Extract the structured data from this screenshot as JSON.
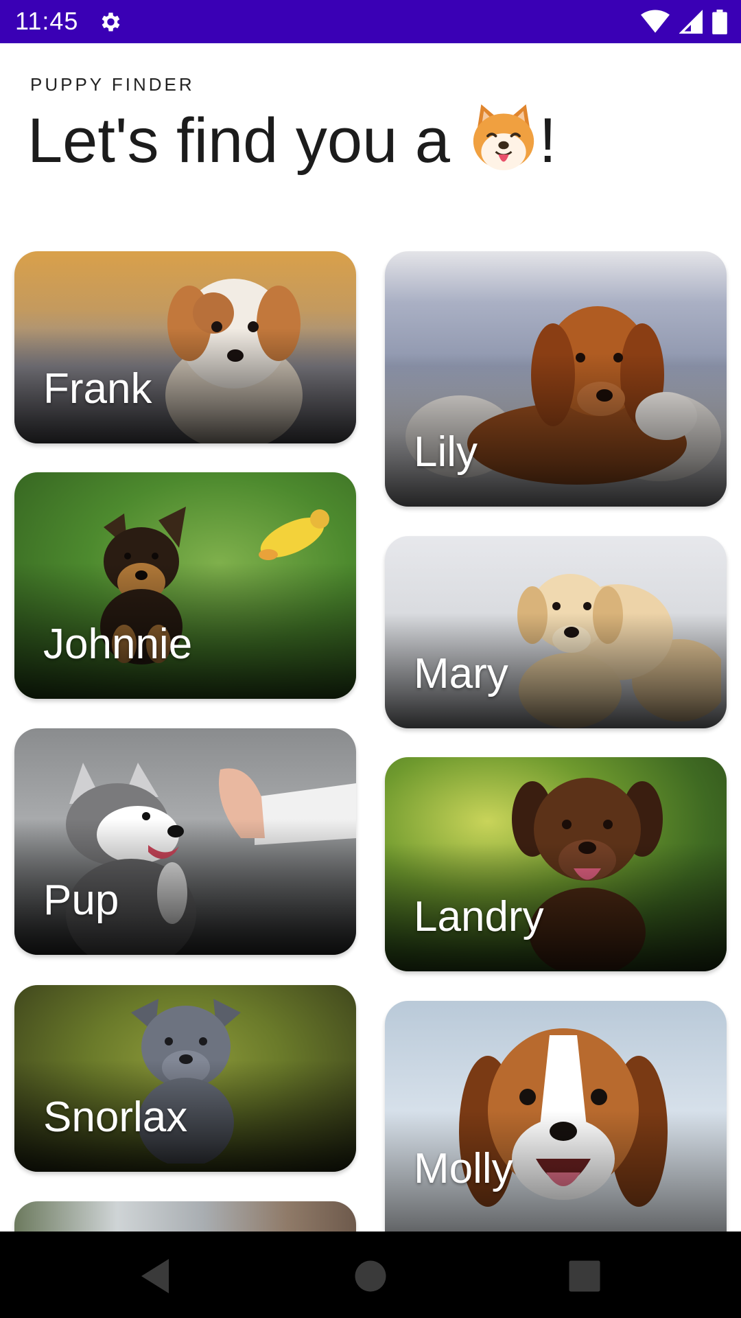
{
  "status_bar": {
    "time": "11:45",
    "icons": [
      "settings-gear-icon",
      "wifi-icon",
      "signal-icon",
      "battery-icon"
    ],
    "background": "#3a00b5"
  },
  "header": {
    "eyebrow": "PUPPY FINDER",
    "title_prefix": "Let's find you a",
    "title_emoji": "dog-face-emoji",
    "title_suffix": "!"
  },
  "puppies": {
    "left": [
      {
        "name": "Frank"
      },
      {
        "name": "Johnnie"
      },
      {
        "name": "Pup"
      },
      {
        "name": "Snorlax"
      }
    ],
    "right": [
      {
        "name": "Lily"
      },
      {
        "name": "Mary"
      },
      {
        "name": "Landry"
      },
      {
        "name": "Molly"
      }
    ]
  },
  "nav_bar": {
    "buttons": [
      "back-icon",
      "home-icon",
      "recents-icon"
    ]
  }
}
